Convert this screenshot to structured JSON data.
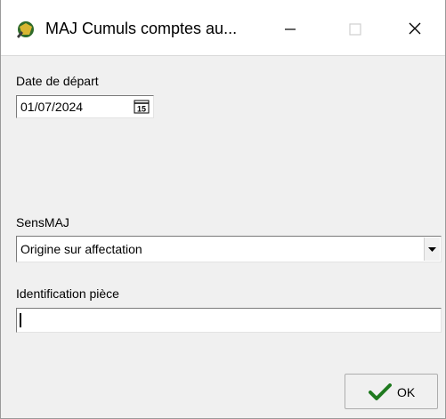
{
  "window": {
    "title": "MAJ Cumuls comptes au..."
  },
  "titlebar": {
    "minimize_icon": "minimize-icon",
    "maximize_icon": "maximize-icon",
    "close_icon": "close-icon"
  },
  "form": {
    "date_label": "Date de départ",
    "date_value": "01/07/2024",
    "calendar_icon": "calendar-icon",
    "sens_label": "SensMAJ",
    "sens_value": "Origine sur affectation",
    "sens_dropdown_icon": "dropdown-arrow-icon",
    "ident_label": "Identification pièce",
    "ident_value": ""
  },
  "footer": {
    "ok_label": "OK",
    "ok_icon": "checkmark-icon"
  },
  "colors": {
    "window_bg": "#f0f0f0",
    "titlebar_bg": "#ffffff",
    "check_green": "#1f7a1f"
  }
}
